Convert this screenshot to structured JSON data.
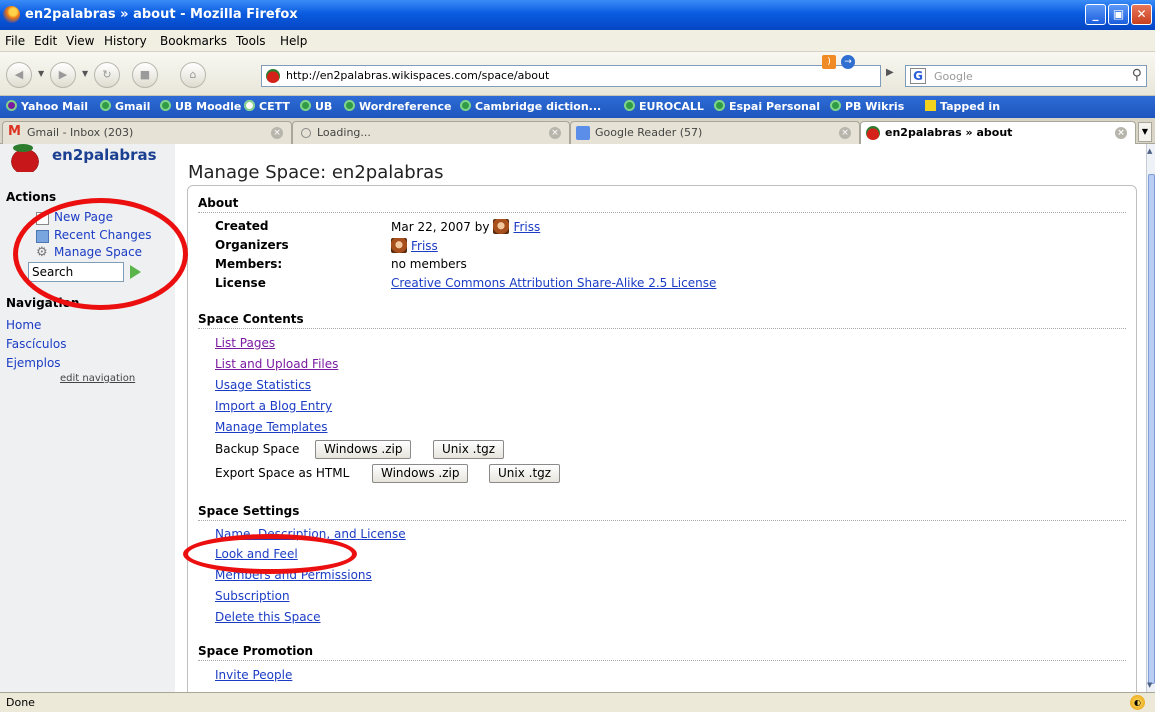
{
  "window": {
    "title": "en2palabras » about - Mozilla Firefox"
  },
  "menu": [
    "File",
    "Edit",
    "View",
    "History",
    "Bookmarks",
    "Tools",
    "Help"
  ],
  "nav": {
    "url": "http://en2palabras.wikispaces.com/space/about",
    "search_placeholder": "Google"
  },
  "bookmarks": [
    "Yahoo Mail",
    "Gmail",
    "UB Moodle",
    "CETT",
    "UB",
    "Wordreference",
    "Cambridge diction...",
    "EUROCALL",
    "Espai Personal",
    "PB Wikris",
    "Tapped in"
  ],
  "tabs": [
    {
      "label": "Gmail - Inbox (203)",
      "active": false
    },
    {
      "label": "Loading...",
      "active": false
    },
    {
      "label": "Google Reader (57)",
      "active": false
    },
    {
      "label": "en2palabras » about",
      "active": true
    }
  ],
  "sidebar": {
    "site_name": "en2palabras",
    "actions_heading": "Actions",
    "actions": [
      "New Page",
      "Recent Changes",
      "Manage Space"
    ],
    "search_value": "Search",
    "navigation_heading": "Navigation",
    "nav_links": [
      "Home",
      "Fascículos",
      "Ejemplos"
    ],
    "edit_navigation": "edit navigation"
  },
  "main": {
    "title": "Manage Space: en2palabras",
    "about": {
      "heading": "About",
      "created_label": "Created",
      "created_value": "Mar 22, 2007 by",
      "created_user": "Friss",
      "organizers_label": "Organizers",
      "organizer": "Friss",
      "members_label": "Members:",
      "members_value": "no members",
      "license_label": "License",
      "license_value": "Creative Commons Attribution Share-Alike 2.5 License"
    },
    "contents": {
      "heading": "Space Contents",
      "links": [
        "List Pages",
        "List and Upload Files",
        "Usage Statistics",
        "Import a Blog Entry",
        "Manage Templates"
      ],
      "backup_label": "Backup Space",
      "export_label": "Export Space as HTML",
      "windows_btn": "Windows .zip",
      "unix_btn": "Unix .tgz"
    },
    "settings": {
      "heading": "Space Settings",
      "links": [
        "Name, Description, and License",
        "Look and Feel",
        "Members and Permissions",
        "Subscription",
        "Delete this Space"
      ]
    },
    "promotion": {
      "heading": "Space Promotion",
      "links": [
        "Invite People"
      ]
    }
  },
  "status": {
    "text": "Done"
  }
}
